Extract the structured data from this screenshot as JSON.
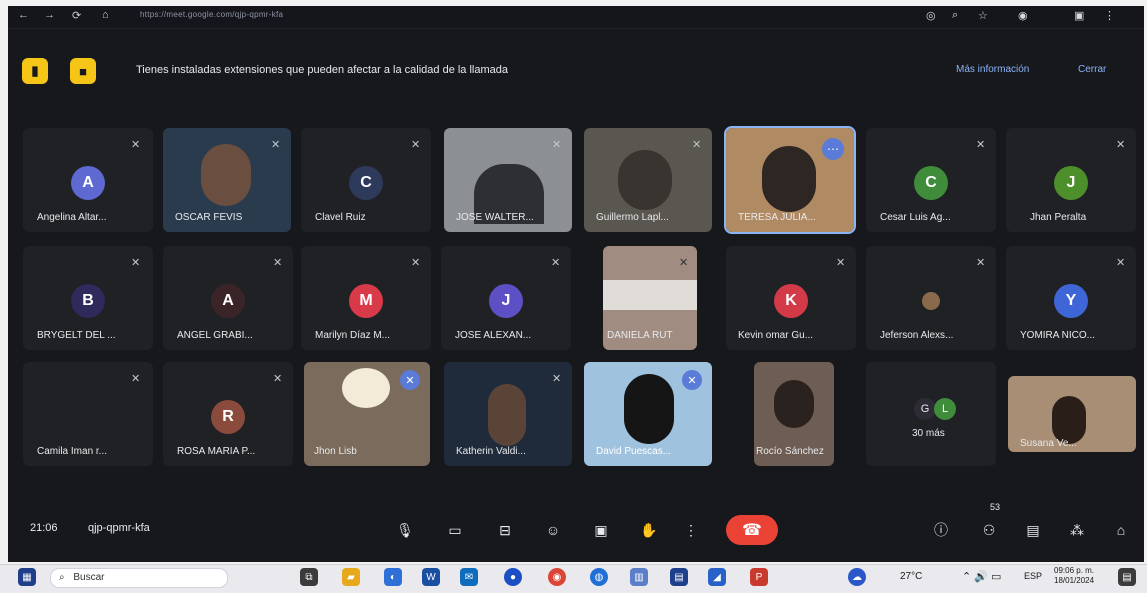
{
  "browser": {
    "url": "https://meet.google.com/qjp-qpmr-kfa",
    "nav_icons": [
      "back-icon",
      "forward-icon",
      "reload-icon",
      "lock-icon"
    ],
    "right_icons": [
      "cast-icon",
      "zoom-icon",
      "star-icon",
      "profile-icon",
      "extension-icon",
      "menu-icon"
    ]
  },
  "banner": {
    "text": "Tienes instaladas extensiones que pueden afectar a la calidad de la llamada",
    "more_info": "Más información",
    "close": "Cerrar"
  },
  "participants": [
    {
      "name": "Angelina Altar..."
    },
    {
      "name": "OSCAR FEVIS"
    },
    {
      "name": "Clavel Ruiz"
    },
    {
      "name": "JOSE WALTER..."
    },
    {
      "name": "Guillermo Lapl..."
    },
    {
      "name": "TERESA JULIA..."
    },
    {
      "name": "Cesar Luis Ag..."
    },
    {
      "name": "Jhan Peralta"
    },
    {
      "name": "BRYGELT DEL ..."
    },
    {
      "name": "ANGEL GRABI..."
    },
    {
      "name": "Marilyn Díaz M..."
    },
    {
      "name": "JOSE ALEXAN..."
    },
    {
      "name": "DANIELA RUT"
    },
    {
      "name": "Kevin omar Gu..."
    },
    {
      "name": "Jeferson Alexs..."
    },
    {
      "name": "YOMIRA NICO..."
    },
    {
      "name": "Camila Iman r..."
    },
    {
      "name": "ROSA MARIA P..."
    },
    {
      "name": "Jhon Lisb"
    },
    {
      "name": "Katherin Valdi..."
    },
    {
      "name": "David Puescas..."
    },
    {
      "name": "Rocío Sánchez"
    },
    {
      "name": "30 más"
    },
    {
      "name": "Susana Ve..."
    }
  ],
  "avatars": {
    "angelina": "A",
    "clavel": "C",
    "cesar": "C",
    "jhan": "J",
    "brygelt": "B",
    "angel": "A",
    "marilyn": "M",
    "jose_alexan": "J",
    "kevin": "K",
    "yomira": "Y",
    "rosa": "R",
    "more_a": "G",
    "more_b": "L"
  },
  "controls": {
    "time": "21:06",
    "meeting_code": "qjp-qpmr-kfa",
    "participant_count": "53"
  },
  "taskbar": {
    "search_label": "Buscar",
    "weather": "27°C",
    "clock_time": "09:06 p. m.",
    "clock_date": "18/01/2024",
    "lang": "ESP"
  },
  "colors": {
    "meet_bg": "#16181c",
    "tile_bg": "#202124",
    "accent": "#8ab4f8",
    "end_call": "#ea4335",
    "extension": "#f5c518"
  }
}
